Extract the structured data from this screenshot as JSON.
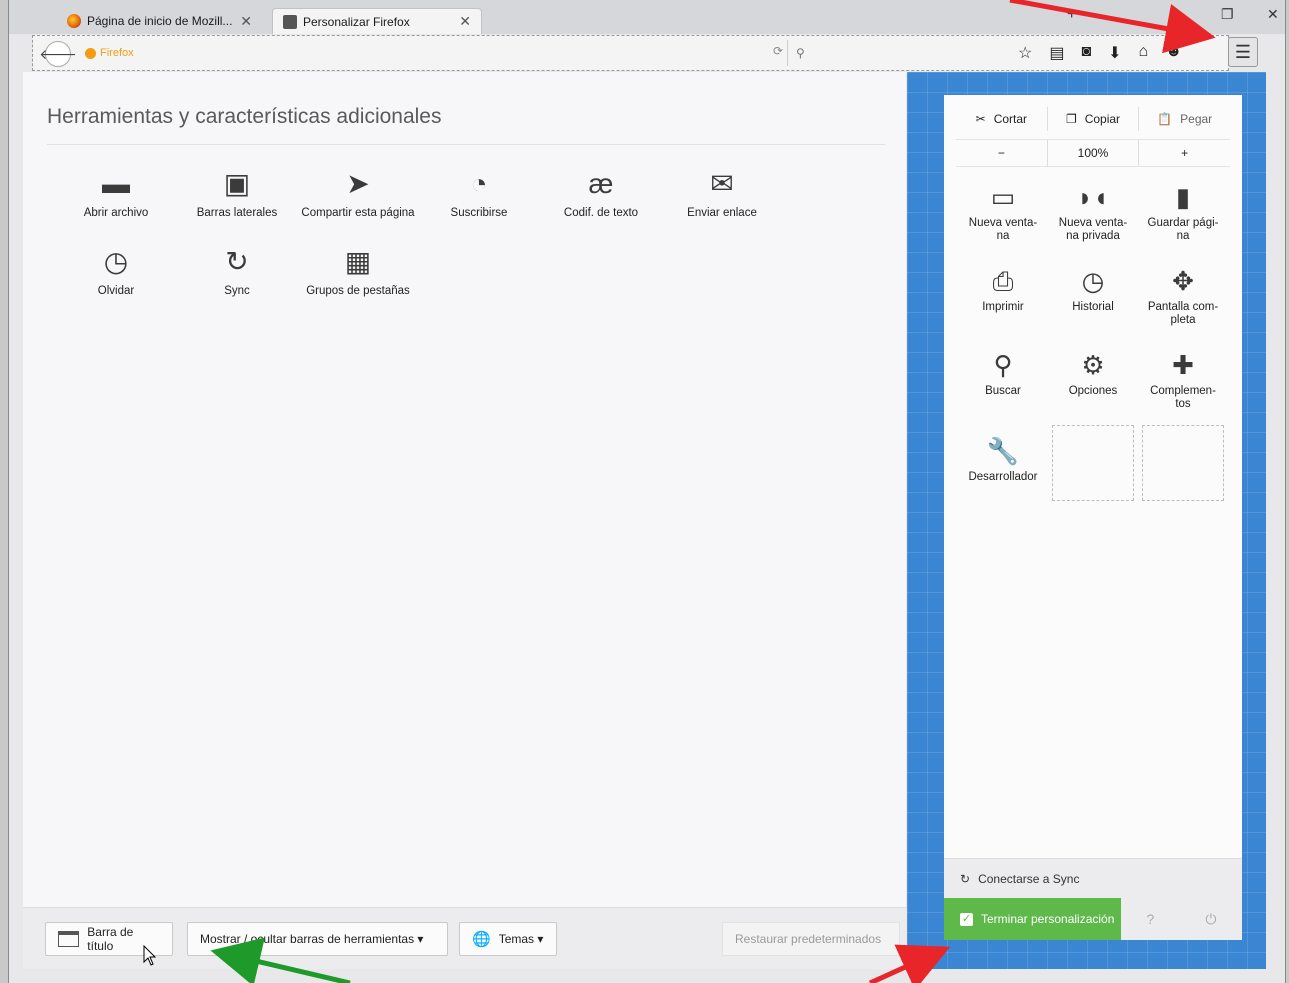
{
  "tabs": [
    {
      "label": "Página de inicio de Mozill..."
    },
    {
      "label": "Personalizar Firefox"
    }
  ],
  "window_controls": {
    "new_tab": "+",
    "restore": "❐",
    "close": "✕"
  },
  "navbar": {
    "url_text": "Firefox",
    "search_placeholder": "",
    "icons": [
      "star-icon",
      "reading-list-icon",
      "pocket-icon",
      "download-icon",
      "home-icon",
      "smiley-icon"
    ]
  },
  "palette": {
    "title": "Herramientas y características adicionales",
    "items": [
      {
        "label": "Abrir archivo",
        "icon": "folder-icon"
      },
      {
        "label": "Barras laterales",
        "icon": "sidebar-icon"
      },
      {
        "label": "Compartir esta página",
        "icon": "share-icon"
      },
      {
        "label": "Suscribirse",
        "icon": "rss-icon"
      },
      {
        "label": "Codif. de texto",
        "icon": "encoding-icon"
      },
      {
        "label": "Enviar enlace",
        "icon": "mail-icon"
      },
      {
        "label": "Olvidar",
        "icon": "forget-icon"
      },
      {
        "label": "Sync",
        "icon": "sync-icon"
      },
      {
        "label": "Grupos de pestañas",
        "icon": "tab-groups-icon"
      }
    ]
  },
  "bottombar": {
    "title_bar": "Barra de título",
    "toolbars": "Mostrar / ocultar barras de herramientas ▾",
    "themes": "Temas ▾",
    "restore": "Restaurar predeterminados"
  },
  "menu_panel": {
    "cut": "Cortar",
    "copy": "Copiar",
    "paste": "Pegar",
    "zoom_out": "−",
    "zoom_level": "100%",
    "zoom_in": "+",
    "items": [
      {
        "label": "Nueva venta-\nna",
        "icon": "new-window-icon"
      },
      {
        "label": "Nueva venta-\nna privada",
        "icon": "private-window-icon"
      },
      {
        "label": "Guardar pági-\nna",
        "icon": "save-page-icon"
      },
      {
        "label": "Imprimir",
        "icon": "print-icon"
      },
      {
        "label": "Historial",
        "icon": "history-icon"
      },
      {
        "label": "Pantalla com-\npleta",
        "icon": "fullscreen-icon"
      },
      {
        "label": "Buscar",
        "icon": "find-icon"
      },
      {
        "label": "Opciones",
        "icon": "options-icon"
      },
      {
        "label": "Complemen-\ntos",
        "icon": "addons-icon"
      },
      {
        "label": "Desarrollador",
        "icon": "developer-icon"
      }
    ],
    "sync": "Conectarse a Sync",
    "finish": "Terminar personalización"
  },
  "colors": {
    "accent_blue": "#3a86d3",
    "finish_green": "#5fb84a",
    "arrow_red": "#e8262a",
    "arrow_green": "#1e9a2a"
  }
}
